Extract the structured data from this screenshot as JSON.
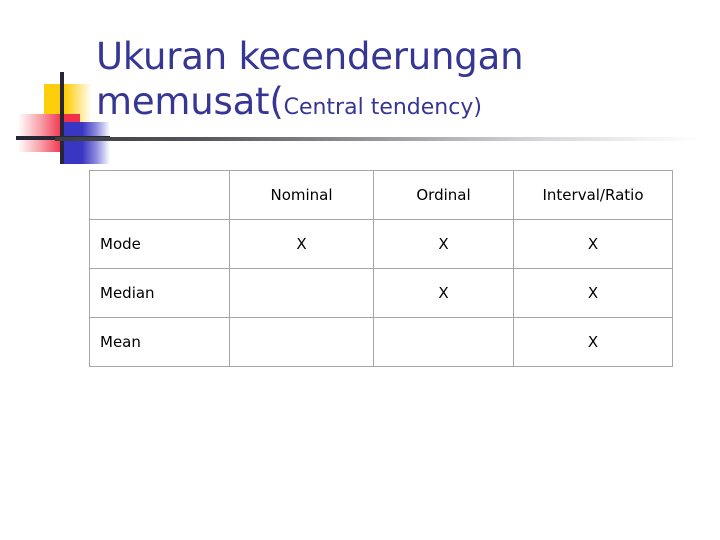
{
  "slide": {
    "background_color": "#ffffff",
    "title": {
      "line1": "Ukuran kecenderungan",
      "line2_main": "memusat(",
      "line2_sub": "Central tendency)",
      "color": "#363694"
    },
    "logo": {
      "name": "decorative-squares-logo",
      "colors": {
        "yellow": "#FFCE0A",
        "red": "#F2304A",
        "blue": "#3A36C4",
        "cross_line": "#262636"
      }
    },
    "divider": {
      "color_start": "#3B3B44",
      "color_end": "#FFFFFF"
    }
  },
  "table": {
    "headers": [
      "",
      "Nominal",
      "Ordinal",
      "Interval/Ratio"
    ],
    "rows": [
      {
        "label": "Mode",
        "cells": [
          "X",
          "X",
          "X"
        ]
      },
      {
        "label": "Median",
        "cells": [
          "",
          "X",
          "X"
        ]
      },
      {
        "label": "Mean",
        "cells": [
          "",
          "",
          "X"
        ]
      }
    ],
    "border_color": "#a6a6a6"
  }
}
